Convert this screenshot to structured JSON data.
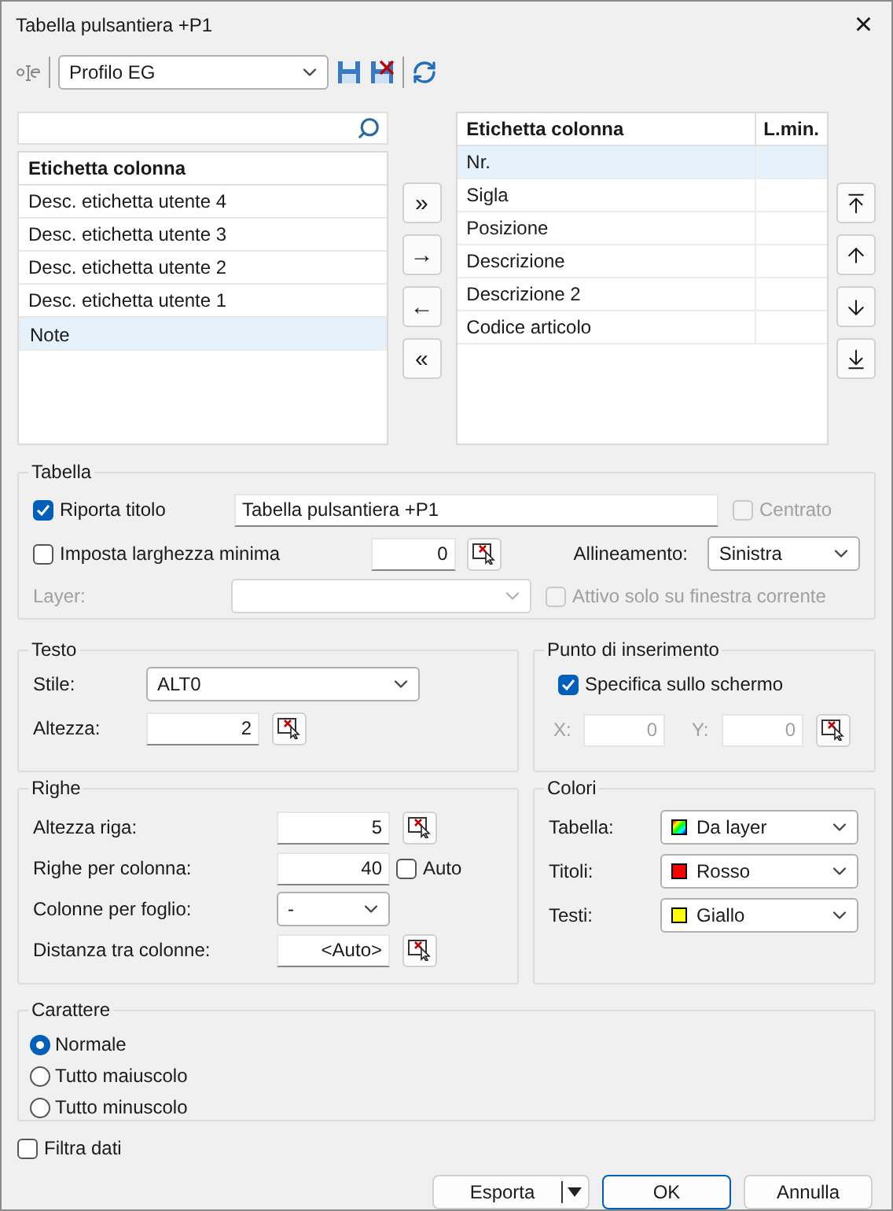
{
  "window": {
    "title": "Tabella pulsantiera +P1",
    "close": "×"
  },
  "toolbar": {
    "profile": "Profilo EG"
  },
  "available_columns": {
    "header": "Etichetta colonna",
    "items": [
      {
        "label": "Desc. etichetta utente 4",
        "selected": false
      },
      {
        "label": "Desc. etichetta utente 3",
        "selected": false
      },
      {
        "label": "Desc. etichetta utente 2",
        "selected": false
      },
      {
        "label": "Desc. etichetta utente 1",
        "selected": false
      },
      {
        "label": "Note",
        "selected": true
      }
    ]
  },
  "transfer_buttons": [
    "»",
    "→",
    "←",
    "«"
  ],
  "selected_columns": {
    "columns": [
      "Etichetta colonna",
      "L.min."
    ],
    "rows": [
      {
        "label": "Nr.",
        "selected": true
      },
      {
        "label": "Sigla",
        "selected": false
      },
      {
        "label": "Posizione",
        "selected": false
      },
      {
        "label": "Descrizione",
        "selected": false
      },
      {
        "label": "Descrizione 2",
        "selected": false
      },
      {
        "label": "Codice articolo",
        "selected": false
      }
    ]
  },
  "tabella": {
    "title": "Tabella",
    "report_title": {
      "label": "Riporta titolo",
      "checked": true
    },
    "title_value": "Tabella pulsantiera +P1",
    "centered": {
      "label": "Centrato",
      "checked": false,
      "disabled": true
    },
    "min_width": {
      "label": "Imposta larghezza minima",
      "checked": false
    },
    "min_width_value": "0",
    "alignment": {
      "label": "Allineamento:",
      "value": "Sinistra"
    },
    "layer": {
      "label": "Layer:",
      "disabled": true
    },
    "current_window_only": {
      "label": "Attivo solo su finestra corrente",
      "checked": false,
      "disabled": true
    }
  },
  "testo": {
    "title": "Testo",
    "style": {
      "label": "Stile:",
      "value": "ALT0"
    },
    "height": {
      "label": "Altezza:",
      "value": "2"
    }
  },
  "insertion_point": {
    "title": "Punto di inserimento",
    "on_screen": {
      "label": "Specifica sullo schermo",
      "checked": true
    },
    "x": {
      "label": "X:",
      "value": "0",
      "disabled": true
    },
    "y": {
      "label": "Y:",
      "value": "0",
      "disabled": true
    }
  },
  "righe": {
    "title": "Righe",
    "row_height": {
      "label": "Altezza riga:",
      "value": "5"
    },
    "rows_per_column": {
      "label": "Righe per colonna:",
      "value": "40"
    },
    "auto": {
      "label": "Auto",
      "checked": false
    },
    "columns_per_sheet": {
      "label": "Colonne per foglio:",
      "value": "-"
    },
    "column_spacing": {
      "label": "Distanza tra colonne:",
      "value": "<Auto>"
    }
  },
  "colori": {
    "title": "Colori",
    "items": [
      {
        "label": "Tabella:",
        "value": "Da layer",
        "kind": "gradient"
      },
      {
        "label": "Titoli:",
        "value": "Rosso",
        "kind": "solid",
        "color": "#ff0000"
      },
      {
        "label": "Testi:",
        "value": "Giallo",
        "kind": "solid",
        "color": "#ffff00"
      }
    ]
  },
  "carattere": {
    "title": "Carattere",
    "options": [
      {
        "label": "Normale",
        "selected": true
      },
      {
        "label": "Tutto maiuscolo",
        "selected": false
      },
      {
        "label": "Tutto minuscolo",
        "selected": false
      }
    ]
  },
  "filter": {
    "label": "Filtra dati",
    "checked": false
  },
  "buttons": {
    "export": "Esporta",
    "ok": "OK",
    "cancel": "Annulla"
  }
}
